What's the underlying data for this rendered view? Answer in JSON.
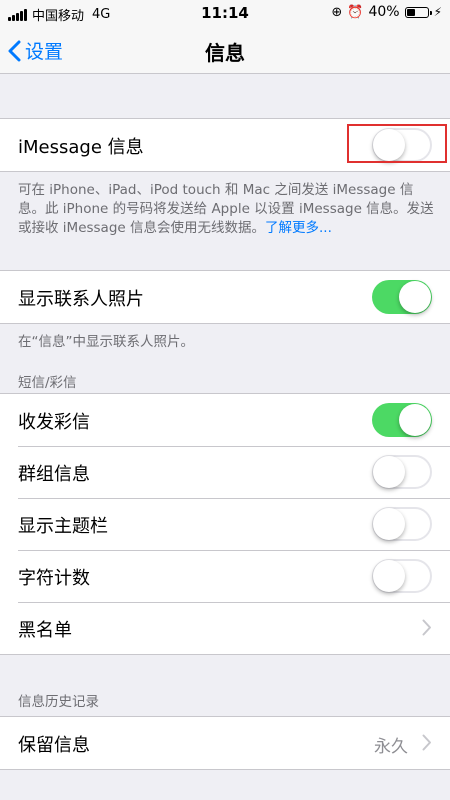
{
  "status_bar": {
    "carrier": "中国移动",
    "network": "4G",
    "time": "11:14",
    "battery": "40%",
    "battery_level": 0.4
  },
  "nav": {
    "back_label": "设置",
    "title": "信息"
  },
  "imessage": {
    "label": "iMessage 信息",
    "enabled": false,
    "footer_text": "可在 iPhone、iPad、iPod touch 和 Mac 之间发送 iMessage 信息。此 iPhone 的号码将发送给 Apple 以设置 iMessage 信息。发送或接收 iMessage 信息会使用无线数据。",
    "footer_link": "了解更多..."
  },
  "contact_photos": {
    "label": "显示联系人照片",
    "enabled": true,
    "footer_text": "在“信息”中显示联系人照片。"
  },
  "sms_mms": {
    "header": "短信/彩信",
    "rows": {
      "mms": {
        "label": "收发彩信",
        "enabled": true
      },
      "group": {
        "label": "群组信息",
        "enabled": false
      },
      "subject": {
        "label": "显示主题栏",
        "enabled": false
      },
      "char_count": {
        "label": "字符计数",
        "enabled": false
      },
      "blocked": {
        "label": "黑名单"
      }
    }
  },
  "history": {
    "header": "信息历史记录",
    "keep_label": "保留信息",
    "keep_value": "永久"
  },
  "colors": {
    "accent": "#007aff",
    "toggle_on": "#4cd964",
    "highlight_border": "#e0302f"
  }
}
